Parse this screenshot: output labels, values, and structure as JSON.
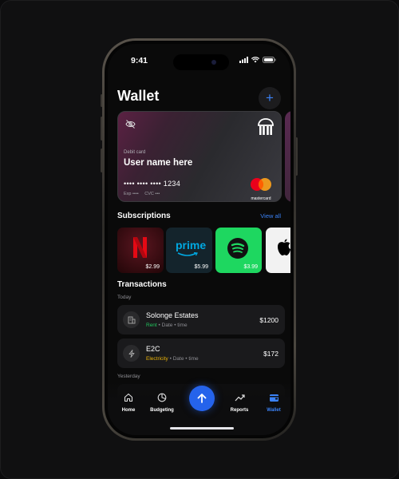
{
  "status": {
    "time": "9:41"
  },
  "header": {
    "title": "Wallet",
    "add_label": "+"
  },
  "card": {
    "type": "Debit card",
    "holder": "User name here",
    "number": "•••• •••• •••• 1234",
    "exp": "Exp ••••",
    "cvc": "CVC •••",
    "network": "mastercard"
  },
  "subscriptions": {
    "title": "Subscriptions",
    "view_all": "View all",
    "items": [
      {
        "name": "netflix",
        "price": "$2.99",
        "color": "#3a0f14"
      },
      {
        "name": "prime",
        "logo": "prime",
        "price": "$5.99",
        "color": "#12232d"
      },
      {
        "name": "spotify",
        "price": "$3.99",
        "color": "#1ed760"
      },
      {
        "name": "apple",
        "price": "",
        "color": "#f2f2f2"
      }
    ]
  },
  "transactions": {
    "title": "Transactions",
    "groups": [
      {
        "label": "Today"
      },
      {
        "label": "Yesterday"
      }
    ],
    "items": [
      {
        "name": "Solonge Estates",
        "category": "Rent",
        "category_color": "#22c55e",
        "date": "Date",
        "time": "time",
        "amount": "$1200"
      },
      {
        "name": "E2C",
        "category": "Electricity",
        "category_color": "#eab308",
        "date": "Date",
        "time": "time",
        "amount": "$172"
      }
    ]
  },
  "nav": {
    "items": [
      {
        "label": "Home"
      },
      {
        "label": "Budgeting"
      },
      {
        "label": "Reports"
      },
      {
        "label": "Wallet",
        "active": true
      }
    ],
    "accent": "#3b82f6"
  }
}
